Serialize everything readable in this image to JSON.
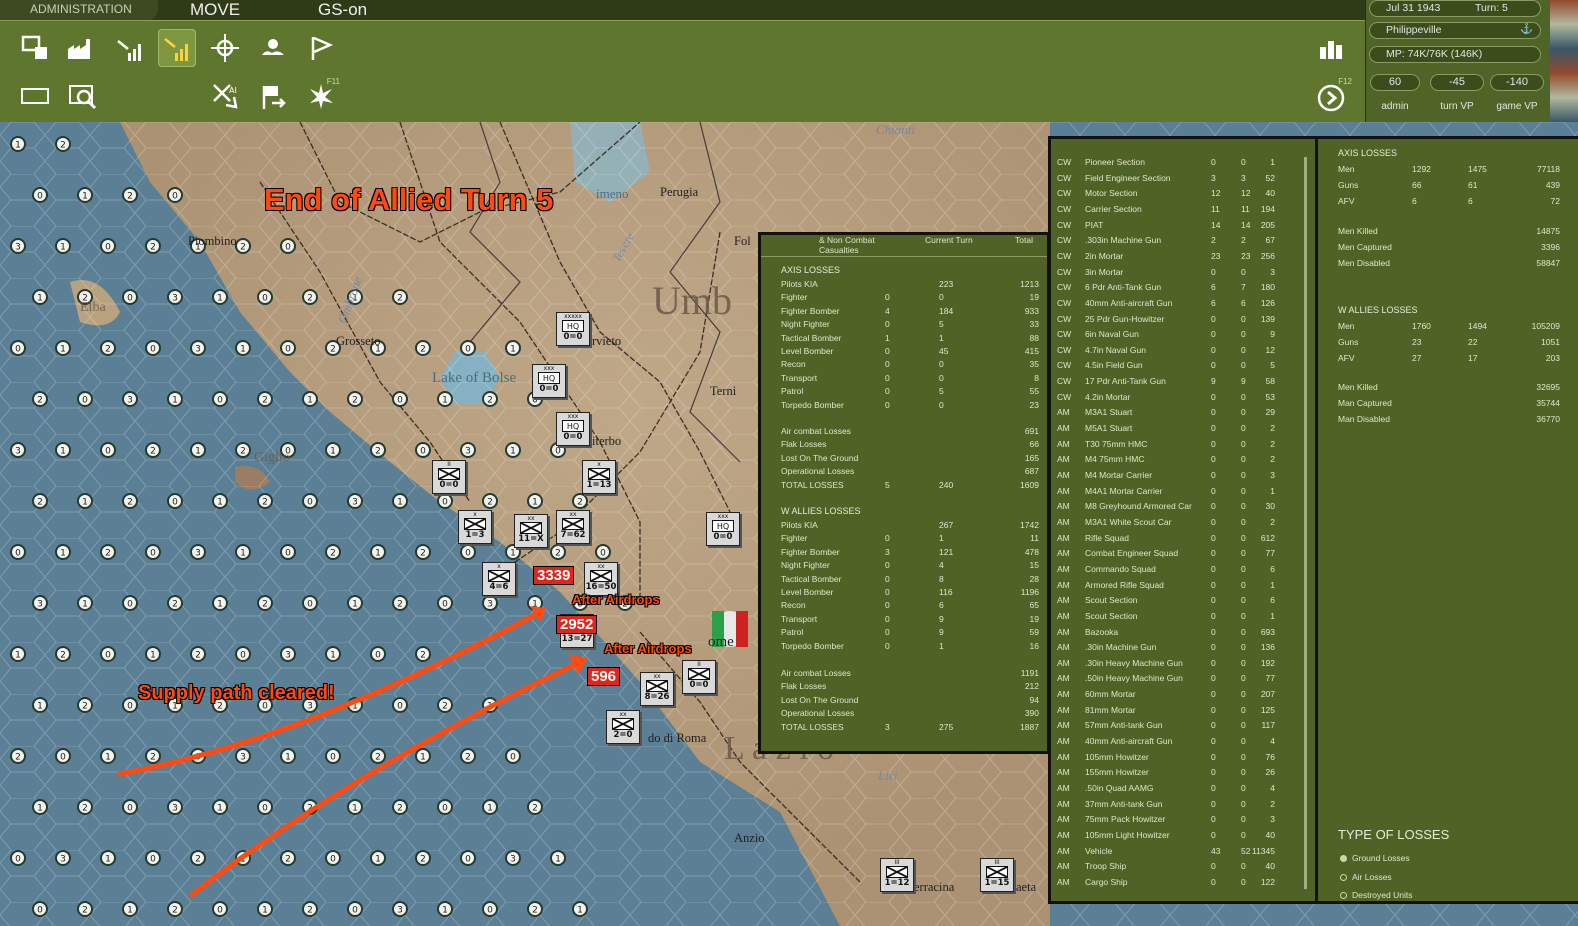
{
  "topbar": {
    "admin": "ADMINISTRATION",
    "mode": "MOVE",
    "gs": "GS-on"
  },
  "toolbar": {
    "f11": "F11",
    "f12": "F12"
  },
  "status": {
    "date": "Jul 31 1943",
    "turn": "Turn: 5",
    "location": "Philippeville",
    "mp": "MP:  74K/76K (146K)",
    "admin_vp": "60",
    "turn_vp": "-45",
    "game_vp": "-140",
    "admin_label": "admin",
    "turn_label": "turn VP",
    "game_label": "game VP"
  },
  "overlays": {
    "title": "End of Allied Turn 5",
    "supply": "Supply path cleared!",
    "airdrop1": "After Airdrops",
    "airdrop2": "After Airdrops",
    "count1": "3339",
    "count2": "2952",
    "count3": "596"
  },
  "cities": [
    {
      "name": "Piombino"
    },
    {
      "name": "Grosseto"
    },
    {
      "name": "Perugia"
    },
    {
      "name": "Orvieto",
      "label": "rvieto"
    },
    {
      "name": "Viterbo",
      "label": "iterbo"
    },
    {
      "name": "Terni"
    },
    {
      "name": "Anzio"
    },
    {
      "name": "Terracina",
      "label": "erracina"
    },
    {
      "name": "Gaeta",
      "label": "aeta"
    },
    {
      "name": "Foligno",
      "label": "Fol"
    },
    {
      "name": "Rome",
      "label": "ome"
    },
    {
      "name": "Lido di Roma",
      "label": "do di Roma"
    }
  ],
  "regions": {
    "umbria": "Umb",
    "lazio": "L a z i o",
    "elba": "Elba",
    "giglio": "Giglio",
    "lake": "Lake of Bolse",
    "trasimeno": "imeno",
    "chianti": "Chianti",
    "ombrone": "Ombrone",
    "tevere": "Tevere",
    "liri": "Liri"
  },
  "units": [
    {
      "top": "xxxxx",
      "label": "HQ",
      "str": "0=0"
    },
    {
      "top": "xxx",
      "label": "HQ",
      "str": "0=0"
    },
    {
      "top": "xxx",
      "label": "HQ",
      "str": "0=0"
    },
    {
      "top": "II",
      "label": "",
      "str": "0=0"
    },
    {
      "top": "x",
      "label": "",
      "str": "1=13"
    },
    {
      "top": "x",
      "label": "",
      "str": "1=3"
    },
    {
      "top": "xx",
      "label": "",
      "str": "11=X"
    },
    {
      "top": "xx",
      "label": "",
      "str": "7=62"
    },
    {
      "top": "xxx",
      "label": "HQ",
      "str": "0=0"
    },
    {
      "top": "x",
      "label": "",
      "str": "4=6"
    },
    {
      "top": "xx",
      "label": "",
      "str": "16=50"
    },
    {
      "top": "xx",
      "label": "",
      "str": "13=27"
    },
    {
      "top": "xx",
      "label": "",
      "str": "8=26"
    },
    {
      "top": "II",
      "label": "",
      "str": "0=0"
    },
    {
      "top": "xx",
      "label": "",
      "str": "2=0"
    },
    {
      "top": "III",
      "label": "",
      "str": "1=12"
    },
    {
      "top": "III",
      "label": "",
      "str": "1=15"
    }
  ],
  "casualties": {
    "headers": [
      "& Non Combat Casualties",
      "Current Turn",
      "Total"
    ],
    "axis_title": "AXIS LOSSES",
    "axis_rows": [
      [
        "Pilots KIA",
        "",
        "223",
        "1213"
      ],
      [
        "Fighter",
        "0",
        "0",
        "19"
      ],
      [
        "Fighter Bomber",
        "4",
        "184",
        "933"
      ],
      [
        "Night Fighter",
        "0",
        "5",
        "33"
      ],
      [
        "Tactical Bomber",
        "1",
        "1",
        "88"
      ],
      [
        "Level Bomber",
        "0",
        "45",
        "415"
      ],
      [
        "Recon",
        "0",
        "0",
        "35"
      ],
      [
        "Transport",
        "0",
        "0",
        "8"
      ],
      [
        "Patrol",
        "0",
        "5",
        "55"
      ],
      [
        "Torpedo Bomber",
        "0",
        "0",
        "23"
      ]
    ],
    "axis_rows2": [
      [
        "Air combat Losses",
        "",
        "",
        "691"
      ],
      [
        "Flak Losses",
        "",
        "",
        "66"
      ],
      [
        "Lost On The Ground",
        "",
        "",
        "165"
      ],
      [
        "Operational Losses",
        "",
        "",
        "687"
      ],
      [
        "TOTAL LOSSES",
        "5",
        "240",
        "1609"
      ]
    ],
    "allies_title": "W ALLIES LOSSES",
    "allies_rows": [
      [
        "Pilots KIA",
        "",
        "267",
        "1742"
      ],
      [
        "Fighter",
        "0",
        "1",
        "11"
      ],
      [
        "Fighter Bomber",
        "3",
        "121",
        "478"
      ],
      [
        "Night Fighter",
        "0",
        "4",
        "15"
      ],
      [
        "Tactical Bomber",
        "0",
        "8",
        "28"
      ],
      [
        "Level Bomber",
        "0",
        "116",
        "1196"
      ],
      [
        "Recon",
        "0",
        "6",
        "65"
      ],
      [
        "Transport",
        "0",
        "9",
        "19"
      ],
      [
        "Patrol",
        "0",
        "9",
        "59"
      ],
      [
        "Torpedo Bomber",
        "0",
        "1",
        "16"
      ]
    ],
    "allies_rows2": [
      [
        "Air combat Losses",
        "",
        "",
        "1191"
      ],
      [
        "Flak Losses",
        "",
        "",
        "212"
      ],
      [
        "Lost On The Ground",
        "",
        "",
        "94"
      ],
      [
        "Operational Losses",
        "",
        "",
        "390"
      ],
      [
        "TOTAL LOSSES",
        "3",
        "275",
        "1887"
      ]
    ]
  },
  "unit_losses": [
    [
      "CW",
      "Pioneer Section",
      "0",
      "0",
      "1"
    ],
    [
      "CW",
      "Field Engineer Section",
      "3",
      "3",
      "52"
    ],
    [
      "CW",
      "Motor Section",
      "12",
      "12",
      "40"
    ],
    [
      "CW",
      "Carrier Section",
      "11",
      "11",
      "194"
    ],
    [
      "CW",
      "PIAT",
      "14",
      "14",
      "205"
    ],
    [
      "CW",
      ".303in Machine Gun",
      "2",
      "2",
      "67"
    ],
    [
      "CW",
      "2in Mortar",
      "23",
      "23",
      "256"
    ],
    [
      "CW",
      "3in Mortar",
      "0",
      "0",
      "3"
    ],
    [
      "CW",
      "6 Pdr Anti-Tank Gun",
      "6",
      "7",
      "180"
    ],
    [
      "CW",
      "40mm Anti-aircraft Gun",
      "6",
      "6",
      "126"
    ],
    [
      "CW",
      "25 Pdr Gun-Howitzer",
      "0",
      "0",
      "139"
    ],
    [
      "CW",
      "6in Naval Gun",
      "0",
      "0",
      "9"
    ],
    [
      "CW",
      "4.7in Naval Gun",
      "0",
      "0",
      "12"
    ],
    [
      "CW",
      "4.5in Field Gun",
      "0",
      "0",
      "5"
    ],
    [
      "CW",
      "17 Pdr Anti-Tank Gun",
      "9",
      "9",
      "58"
    ],
    [
      "CW",
      "4.2in Mortar",
      "0",
      "0",
      "53"
    ],
    [
      "AM",
      "M3A1 Stuart",
      "0",
      "0",
      "29"
    ],
    [
      "AM",
      "M5A1 Stuart",
      "0",
      "0",
      "2"
    ],
    [
      "AM",
      "T30 75mm HMC",
      "0",
      "0",
      "2"
    ],
    [
      "AM",
      "M4 75mm HMC",
      "0",
      "0",
      "2"
    ],
    [
      "AM",
      "M4 Mortar Carrier",
      "0",
      "0",
      "3"
    ],
    [
      "AM",
      "M4A1 Mortar Carrier",
      "0",
      "0",
      "1"
    ],
    [
      "AM",
      "M8 Greyhound Armored Car",
      "0",
      "0",
      "30"
    ],
    [
      "AM",
      "M3A1 White Scout Car",
      "0",
      "0",
      "2"
    ],
    [
      "AM",
      "Rifle Squad",
      "0",
      "0",
      "612"
    ],
    [
      "AM",
      "Combat Engineer Squad",
      "0",
      "0",
      "77"
    ],
    [
      "AM",
      "Commando Squad",
      "0",
      "0",
      "6"
    ],
    [
      "AM",
      "Armored Rifle Squad",
      "0",
      "0",
      "1"
    ],
    [
      "AM",
      "Scout Section",
      "0",
      "0",
      "6"
    ],
    [
      "AM",
      "Scout Section",
      "0",
      "0",
      "1"
    ],
    [
      "AM",
      "Bazooka",
      "0",
      "0",
      "693"
    ],
    [
      "AM",
      ".30in Machine Gun",
      "0",
      "0",
      "136"
    ],
    [
      "AM",
      ".30in Heavy Machine Gun",
      "0",
      "0",
      "192"
    ],
    [
      "AM",
      ".50in Heavy Machine Gun",
      "0",
      "0",
      "77"
    ],
    [
      "AM",
      "60mm Mortar",
      "0",
      "0",
      "207"
    ],
    [
      "AM",
      "81mm Mortar",
      "0",
      "0",
      "125"
    ],
    [
      "AM",
      "57mm Anti-tank Gun",
      "0",
      "0",
      "117"
    ],
    [
      "AM",
      "40mm Anti-aircraft Gun",
      "0",
      "0",
      "4"
    ],
    [
      "AM",
      "105mm Howitzer",
      "0",
      "0",
      "76"
    ],
    [
      "AM",
      "155mm Howitzer",
      "0",
      "0",
      "26"
    ],
    [
      "AM",
      ".50in Quad AAMG",
      "0",
      "0",
      "4"
    ],
    [
      "AM",
      "37mm Anti-tank Gun",
      "0",
      "0",
      "2"
    ],
    [
      "AM",
      "75mm Pack Howitzer",
      "0",
      "0",
      "3"
    ],
    [
      "AM",
      "105mm Light Howitzer",
      "0",
      "0",
      "40"
    ],
    [
      "AM",
      "Vehicle",
      "43",
      "52",
      "11345"
    ],
    [
      "AM",
      "Troop Ship",
      "0",
      "0",
      "40"
    ],
    [
      "AM",
      "Cargo Ship",
      "0",
      "0",
      "122"
    ]
  ],
  "summary": {
    "axis_title": "AXIS LOSSES",
    "axis_rows": [
      [
        "Men",
        "1292",
        "1475",
        "77118"
      ],
      [
        "Guns",
        "66",
        "61",
        "439"
      ],
      [
        "AFV",
        "6",
        "6",
        "72"
      ]
    ],
    "axis_rows2": [
      [
        "Men Killed",
        "",
        "",
        "14875"
      ],
      [
        "Men Captured",
        "",
        "",
        "3396"
      ],
      [
        "Men Disabled",
        "",
        "",
        "58847"
      ]
    ],
    "allies_title": "W ALLIES LOSSES",
    "allies_rows": [
      [
        "Men",
        "1760",
        "1494",
        "105209"
      ],
      [
        "Guns",
        "23",
        "22",
        "1051"
      ],
      [
        "AFV",
        "27",
        "17",
        "203"
      ]
    ],
    "allies_rows2": [
      [
        "Men Killed",
        "",
        "",
        "32695"
      ],
      [
        "Man Captured",
        "",
        "",
        "35744"
      ],
      [
        "Man Disabled",
        "",
        "",
        "36770"
      ]
    ],
    "type_title": "TYPE OF LOSSES",
    "options": [
      "Ground Losses",
      "Air Losses",
      "Destroyed Units"
    ]
  }
}
